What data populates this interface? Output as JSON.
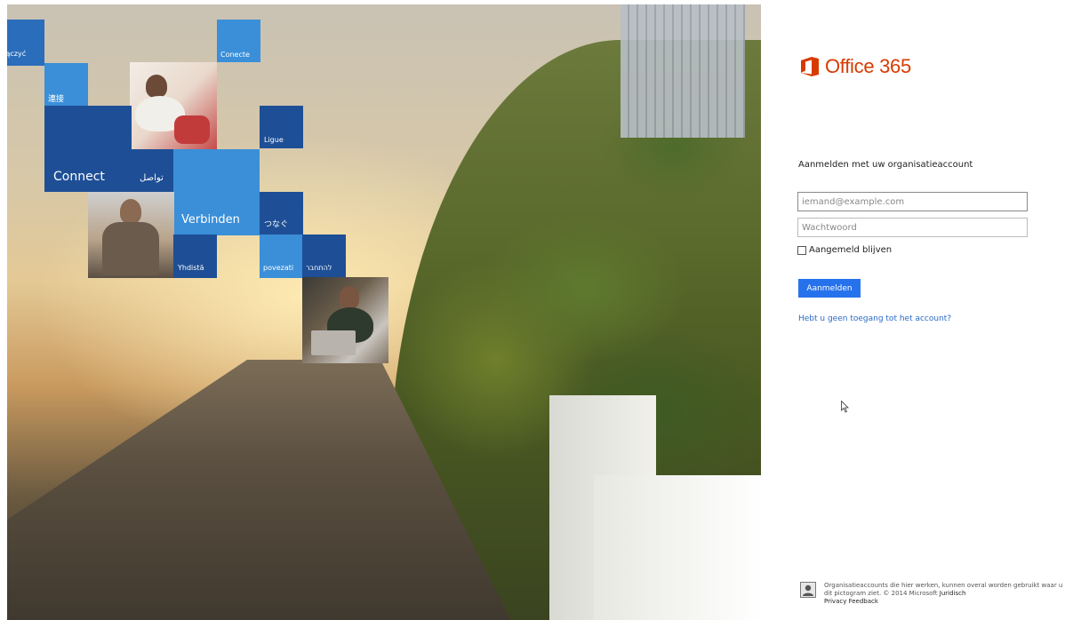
{
  "hero": {
    "tiles": {
      "laczyc": "Łączyć",
      "conecte": "Conecte",
      "lianjie": "連接",
      "ligue": "Ligue",
      "connect": "Connect",
      "tawasol": "تواصل",
      "verbinden": "Verbinden",
      "tsunagu": "つなぐ",
      "yhdista": "Yhdistä",
      "povezati": "povezati",
      "lehitchaber": "להתחבר"
    }
  },
  "brand": {
    "name": "Office 365",
    "color": "#d83b01"
  },
  "signin": {
    "heading": "Aanmelden met uw organisatieaccount",
    "email_placeholder": "iemand@example.com",
    "password_placeholder": "Wachtwoord",
    "remember_label": "Aangemeld blijven",
    "button_label": "Aanmelden",
    "button_color": "#2672ec",
    "no_access_link": "Hebt u geen toegang tot het account?"
  },
  "footer": {
    "text": "Organisatieaccounts die hier werken, kunnen overal worden gebruikt waar u dit pictogram ziet. © 2014 Microsoft",
    "legal": "Juridisch",
    "privacy": "Privacy",
    "feedback": "Feedback"
  }
}
